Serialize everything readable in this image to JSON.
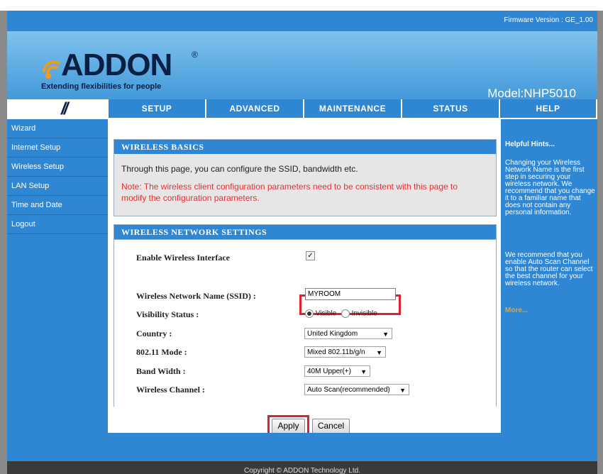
{
  "firmware": "Firmware Version : GE_1.00",
  "logo": {
    "brand": "ADDON",
    "reg": "®",
    "tagline": "Extending flexibilities for people"
  },
  "model": "Model:NHP5010",
  "nav": {
    "slash": "//",
    "tabs": [
      "SETUP",
      "ADVANCED",
      "MAINTENANCE",
      "STATUS",
      "HELP"
    ]
  },
  "sidebar": [
    "Wizard",
    "Internet Setup",
    "Wireless Setup",
    "LAN Setup",
    "Time and Date",
    "Logout"
  ],
  "basics": {
    "title": "WIRELESS BASICS",
    "text": "Through this page, you can configure the SSID, bandwidth etc.",
    "note": "Note: The wireless client configuration parameters need to be consistent with this page to modify the configuration parameters."
  },
  "settings": {
    "title": "WIRELESS NETWORK SETTINGS",
    "enable_label": "Enable Wireless Interface",
    "enable_checked": true,
    "ssid_label": "Wireless Network Name (SSID) :",
    "ssid_value": "MYROOM",
    "visibility_label": "Visibility Status :",
    "visibility_options": [
      "Visible",
      "Invisible"
    ],
    "visibility_selected": "Visible",
    "country_label": "Country :",
    "country_value": "United Kingdom",
    "mode_label": "802.11 Mode :",
    "mode_value": "Mixed 802.11b/g/n",
    "bandwidth_label": "Band Width :",
    "bandwidth_value": "40M Upper(+)",
    "channel_label": "Wireless Channel :",
    "channel_value": "Auto Scan(recommended)"
  },
  "buttons": {
    "apply": "Apply",
    "cancel": "Cancel"
  },
  "hints": {
    "title": "Helpful Hints...",
    "p1": "Changing your Wireless Network Name is the first step in securing your wireless network. We recommend that you change it to a familiar name that does not contain any personal information.",
    "p2": "We recommend that you enable Auto Scan Channel so that the router can select the best channel for your wireless network.",
    "more": "More..."
  },
  "footer": "Copyright © ADDON Technology Ltd.",
  "colors": {
    "primary": "#2f86d3",
    "highlight": "#e0202e",
    "note": "#e83030",
    "more": "#f5a020"
  }
}
